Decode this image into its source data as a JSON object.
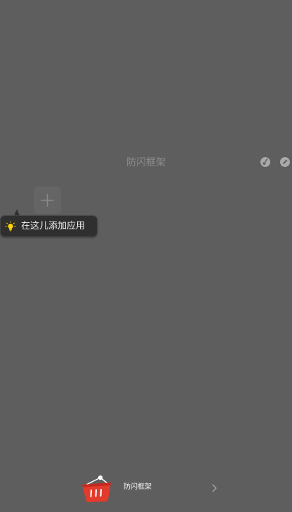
{
  "folder": {
    "title": "防闪框架"
  },
  "header_icons": [
    "clean-icon",
    "edit-icon"
  ],
  "add_button": {
    "icon": "plus-icon"
  },
  "tip": {
    "icon": "lightbulb-icon",
    "text": "在这儿添加应用"
  },
  "bottom_bar": {
    "icon": "basket-icon",
    "label": "防闪框架",
    "chevron": "chevron-right-icon"
  },
  "colors": {
    "background": "#5e5e5e",
    "title_text": "#8d8d8d",
    "tip_background": "#2f2f2f",
    "bulb": "#ffd400",
    "basket_red": "#e23a2c"
  }
}
